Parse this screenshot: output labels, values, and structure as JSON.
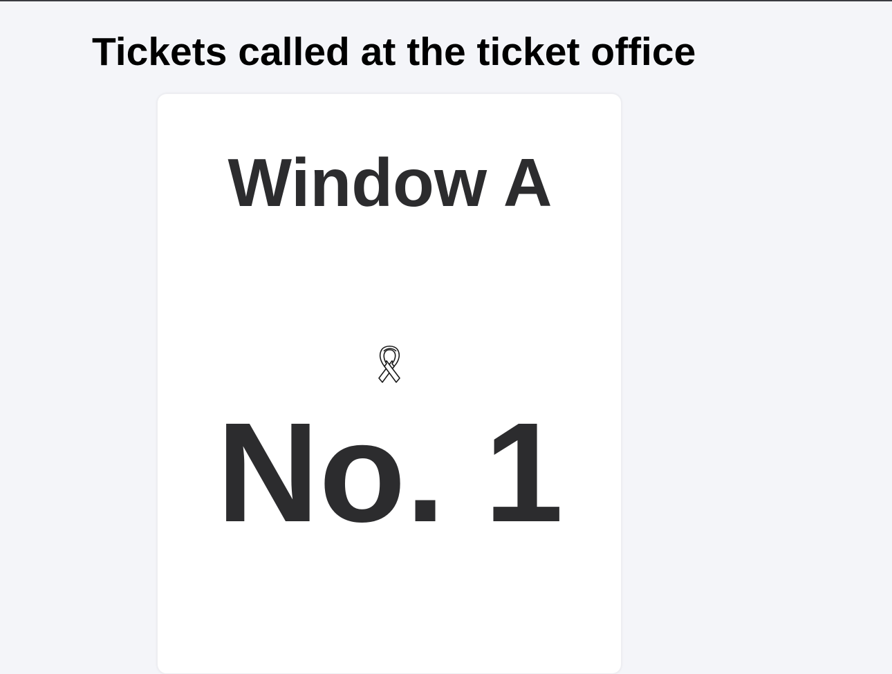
{
  "page": {
    "title": "Tickets called at the ticket office"
  },
  "ticket": {
    "window": "Window A",
    "number": "No. 1",
    "icon": "ribbon-icon"
  },
  "colors": {
    "background": "#f4f5f9",
    "card": "#ffffff",
    "text": "#2c2c2e",
    "title": "#000000"
  }
}
